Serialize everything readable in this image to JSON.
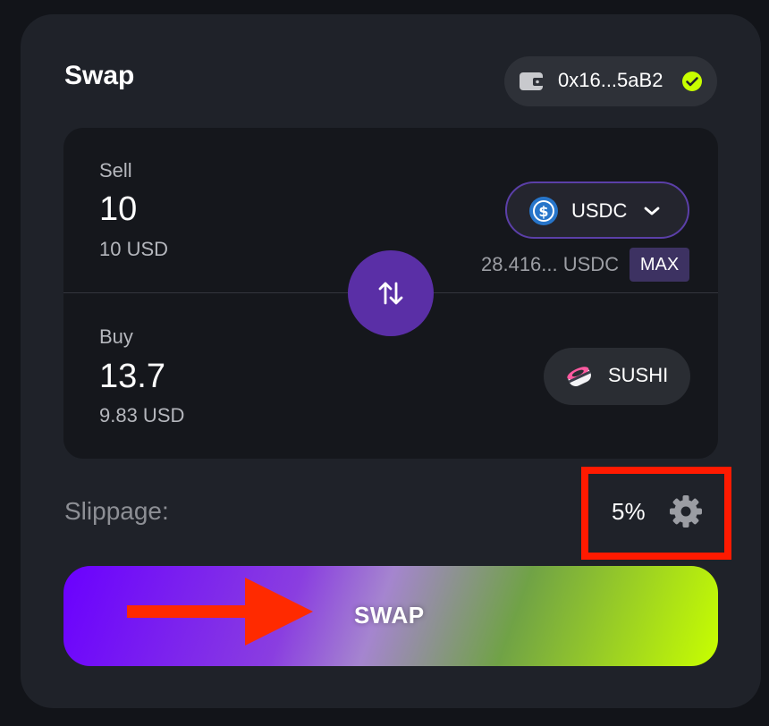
{
  "header": {
    "title": "Swap"
  },
  "wallet": {
    "address": "0x16...5aB2",
    "icon": "wallet-icon",
    "status_icon": "check-icon"
  },
  "sell": {
    "label": "Sell",
    "amount": "10",
    "usd": "10 USD",
    "token": {
      "symbol": "USDC",
      "icon": "usdc-icon"
    },
    "balance": "28.416... USDC",
    "max_label": "MAX"
  },
  "buy": {
    "label": "Buy",
    "amount": "13.7",
    "usd": "9.83 USD",
    "token": {
      "symbol": "SUSHI",
      "icon": "sushi-icon"
    }
  },
  "slippage": {
    "label": "Slippage:",
    "value": "5%"
  },
  "action": {
    "swap_label": "SWAP"
  },
  "colors": {
    "accent": "#5a2fa6",
    "highlight": "#ff1a00",
    "gradient_start": "#6a00ff",
    "gradient_end": "#c8ff00"
  }
}
